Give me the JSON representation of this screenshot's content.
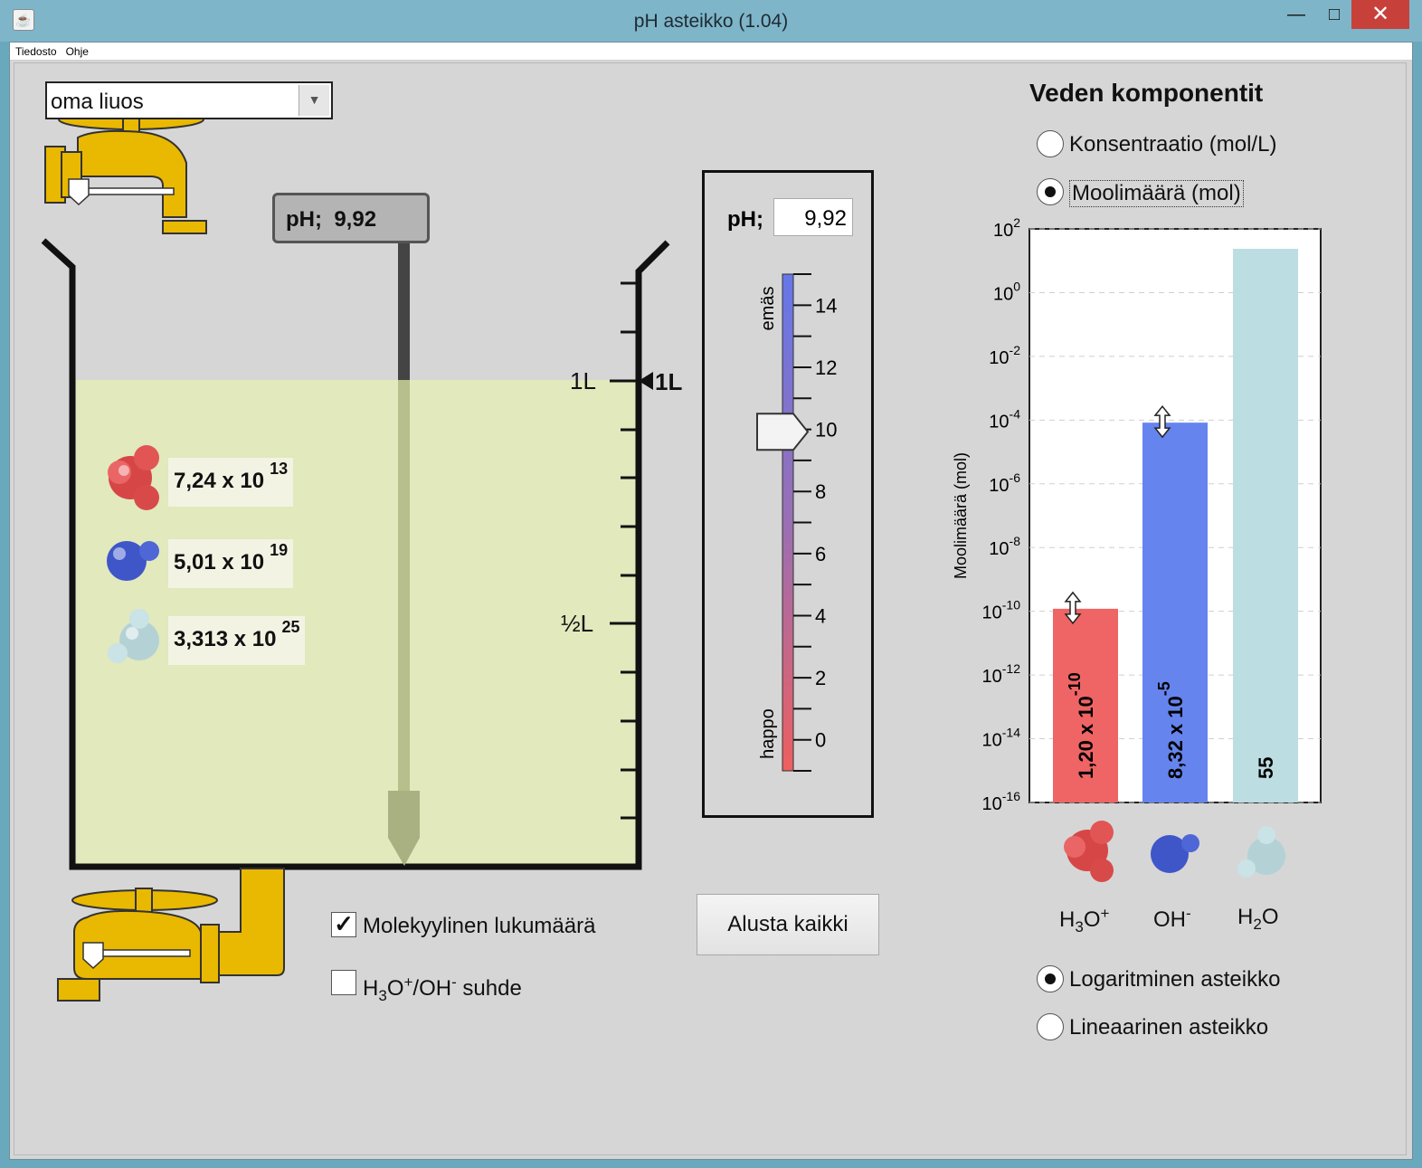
{
  "window": {
    "title": "pH asteikko (1.04)",
    "app_icon": "java-icon",
    "minimize": "—",
    "maximize": "□",
    "close": "✕"
  },
  "menu": [
    "Tiedosto",
    "Ohje"
  ],
  "solution_select": {
    "value": "oma liuos",
    "icon": "chevron-down-icon"
  },
  "probe": {
    "label": "pH;",
    "value": "9,92"
  },
  "beaker": {
    "volume_label": "1L",
    "half_label": "½L",
    "level_marker": "1L",
    "liquid_color": "#e1e9bd",
    "counts": [
      {
        "species": "H3O+",
        "mantissa": "7,24 x 10",
        "exponent": "13"
      },
      {
        "species": "OH-",
        "mantissa": "5,01 x 10",
        "exponent": "19"
      },
      {
        "species": "H2O",
        "mantissa": "3,313 x 10",
        "exponent": "25"
      }
    ]
  },
  "ph_meter": {
    "label": "pH;",
    "value": "9,92",
    "value_numeric": 9.92,
    "ticks": [
      "14",
      "12",
      "10",
      "8",
      "6",
      "4",
      "2",
      "0"
    ],
    "top_label": "emäs",
    "bottom_label": "happo",
    "range": [
      -1,
      15
    ]
  },
  "options": {
    "molecule_count": {
      "label": "Molekyylinen lukumäärä",
      "checked": true
    },
    "ratio": {
      "label_h3o": "H",
      "sub3": "3",
      "o": "O",
      "plus": "+",
      "slash_oh": "/OH",
      "minus": "-",
      "suffix": " suhde",
      "checked": false
    }
  },
  "reset_button": "Alusta kaikki",
  "side": {
    "title": "Veden komponentit",
    "unit_options": [
      {
        "label": "Konsentraatio  (mol/L)",
        "selected": false
      },
      {
        "label": "Moolimäärä (mol)",
        "selected": true
      }
    ],
    "scale_options": [
      {
        "label": "Logaritminen asteikko",
        "selected": true
      },
      {
        "label": "Lineaarinen asteikko",
        "selected": false
      }
    ],
    "species_labels": [
      {
        "base": "H",
        "sub": "3",
        "rest": "O",
        "sup": "+"
      },
      {
        "base": "OH",
        "sub": "",
        "rest": "",
        "sup": "-"
      },
      {
        "base": "H",
        "sub": "2",
        "rest": "O",
        "sup": ""
      }
    ]
  },
  "chart_data": {
    "type": "bar",
    "ylabel": "Moolimäärä (mol)",
    "log_scale": true,
    "ylim_exponent": [
      -16,
      2
    ],
    "ytick_exponents": [
      "2",
      "0",
      "-2",
      "-4",
      "-6",
      "-8",
      "-10",
      "-12",
      "-14",
      "-16"
    ],
    "ytick_base": "10",
    "grid": true,
    "categories": [
      "H3O+",
      "OH-",
      "H2O"
    ],
    "values": [
      1.2e-10,
      8.32e-05,
      55
    ],
    "bar_labels": [
      {
        "mantissa": "1,20 x 10",
        "exponent": "-10"
      },
      {
        "mantissa": "8,32 x 10",
        "exponent": "-5"
      },
      {
        "mantissa": "55",
        "exponent": ""
      }
    ],
    "colors": [
      "#ef6464",
      "#6684ee",
      "#bcdde2"
    ]
  }
}
